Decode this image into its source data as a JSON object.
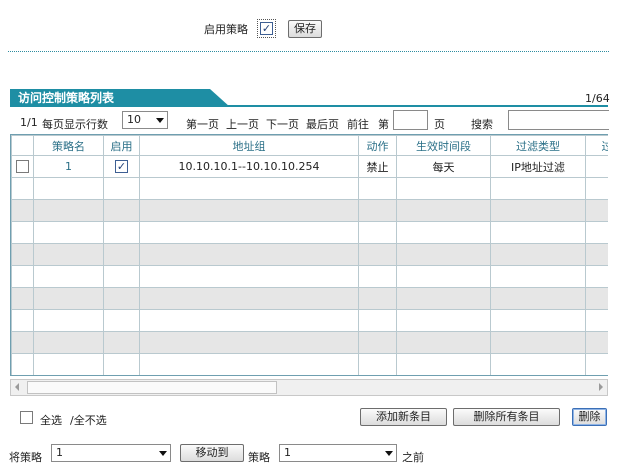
{
  "top": {
    "enable_label": "启用策略",
    "enable_checked": "✓",
    "save_label": "保存"
  },
  "list": {
    "tab_title": "访问控制策略列表",
    "page_count": "1/64",
    "page_indicator": "1/1",
    "rows_per_page_label": "每页显示行数",
    "rows_per_page_value": "10",
    "first_page": "第一页",
    "prev_page": "上一页",
    "next_page": "下一页",
    "last_page": "最后页",
    "goto_label": "前往",
    "page_prefix": "第",
    "page_suffix": "页",
    "search_label": "搜索"
  },
  "table": {
    "headers": [
      "",
      "策略名",
      "启用",
      "地址组",
      "动作",
      "生效时间段",
      "过滤类型",
      "过滤"
    ],
    "rows": [
      {
        "name": "1",
        "enabled": "✓",
        "address_group": "10.10.10.1--10.10.10.254",
        "action": "禁止",
        "schedule": "每天",
        "filter_type": "IP地址过滤",
        "filter": ""
      }
    ]
  },
  "actions": {
    "select_all": "全选",
    "select_none": "/全不选",
    "add_new": "添加新条目",
    "delete_all": "删除所有条目",
    "delete": "删除"
  },
  "move": {
    "prefix_label": "将策略",
    "source_value": "1",
    "move_button": "移动到",
    "middle_label": "策略",
    "target_value": "1",
    "suffix_label": "之前"
  }
}
